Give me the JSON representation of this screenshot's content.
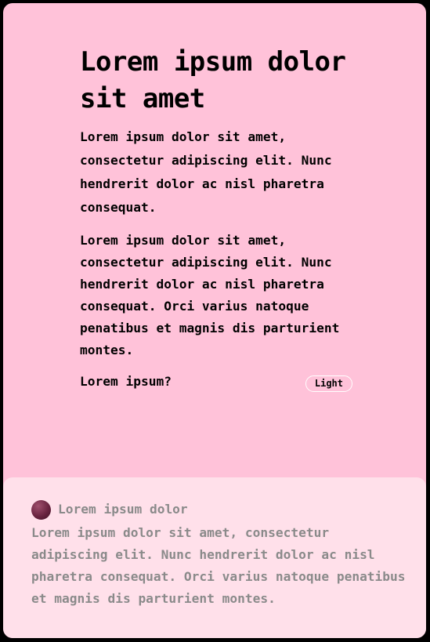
{
  "header": {
    "title": "Lorem ipsum dolor sit amet"
  },
  "main": {
    "lede": "Lorem ipsum dolor sit amet, consectetur adipiscing elit. Nunc hendrerit dolor ac nisl pharetra consequat.",
    "paragraph": "Lorem ipsum dolor sit amet, consectetur adipiscing elit. Nunc hendrerit dolor ac nisl pharetra consequat. Orci varius natoque penatibus et magnis dis parturient montes.",
    "question": "Lorem ipsum?",
    "theme_toggle_label": "Light"
  },
  "footer": {
    "author": "Lorem ipsum dolor",
    "text": "Lorem ipsum dolor sit amet, consectetur adipiscing elit. Nunc hendrerit dolor ac nisl pharetra consequat. Orci varius natoque penatibus et magnis dis parturient montes."
  },
  "colors": {
    "page_background": "#000000",
    "card_background": "#ffc2d9",
    "footer_background": "#ffe0ea",
    "footer_text": "#8a8a8a",
    "avatar": "#6a2440"
  }
}
